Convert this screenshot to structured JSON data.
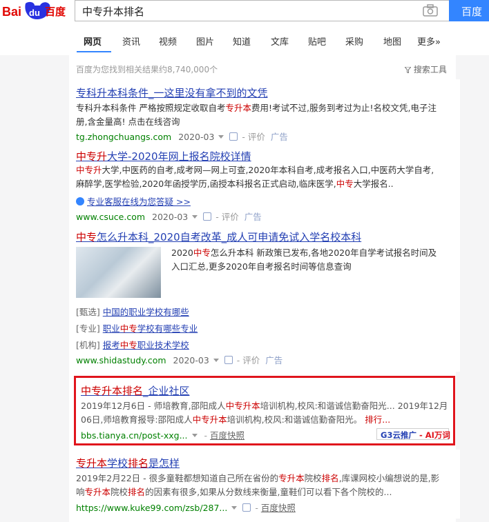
{
  "header": {
    "logo": {
      "bai": "Bai",
      "du": "du",
      "cn": "百度"
    },
    "query": "中专升本排名",
    "search_button": "百度一"
  },
  "tabs": [
    {
      "label": "网页",
      "active": true
    },
    {
      "label": "资讯"
    },
    {
      "label": "视频"
    },
    {
      "label": "图片"
    },
    {
      "label": "知道"
    },
    {
      "label": "文库"
    },
    {
      "label": "贴吧"
    },
    {
      "label": "采购"
    },
    {
      "label": "地图"
    },
    {
      "label": "更多»"
    }
  ],
  "result_count": "百度为您找到相关结果约8,740,000个",
  "search_tools": "搜索工具",
  "results": [
    {
      "title_parts": [
        "专科升本科条件_一这里没有拿不到的文凭"
      ],
      "desc_lines": [
        [
          "专科升本科条件 严格按照规定收取自考",
          {
            "r": "专升本"
          },
          "费用!考试不过,服务到考过为止!名校文凭,电子注"
        ],
        [
          "册,含金量高! 点击在线咨询"
        ]
      ],
      "url": "tg.zhongchuangs.com",
      "date": "2020-03",
      "review": "评价",
      "ad": "广告"
    },
    {
      "title_parts": [
        {
          "r": "中专升"
        },
        "大学-2020年网上报名院校详情"
      ],
      "desc_lines": [
        [
          {
            "r": "中专升"
          },
          "大学,中医药的自考,成考网—网上可查,2020年本科自考,成考报名入口,中医药大学自考,"
        ],
        [
          "麻醉学,医学检验,2020年函授学历,函授本科报名正式启动,临床医学,",
          {
            "r": "中专"
          },
          "大学报名.."
        ]
      ],
      "consult": "专业客服在线为您答疑 >>",
      "url": "www.csuce.com",
      "date": "2020-03",
      "review": "评价",
      "ad": "广告"
    },
    {
      "title_parts": [
        {
          "r": "中专"
        },
        "怎么升本科_2020自考改革_成人可申请免试入学名校本科"
      ],
      "desc_lines": [
        [
          "2020",
          {
            "r": "中专"
          },
          "怎么升本科 新政策已发布,各地2020年自学考试报名时间及"
        ],
        [
          "入口汇总,更多2020年自考报名时间等信息查询"
        ]
      ],
      "sublinks": [
        {
          "tag": "[甄选]",
          "parts": [
            "中国的职业学校有哪些"
          ]
        },
        {
          "tag": "[专业]",
          "parts": [
            "职业",
            {
              "r": "中专"
            },
            "学校有哪些专业"
          ]
        },
        {
          "tag": "[机构]",
          "parts": [
            "报考",
            {
              "r": "中专"
            },
            "职业技术学校"
          ]
        }
      ],
      "url": "www.shidastudy.com",
      "date": "2020-03",
      "review": "评价",
      "ad": "广告"
    },
    {
      "title_parts": [
        {
          "r": "中专升本排名"
        },
        "_企业社区"
      ],
      "desc_lines": [
        [
          "2019年12月6日 - 师培教育,邵阳成人",
          {
            "r": "中专升本"
          },
          "培训机构,校风:和谐诚信勤奋阳光... 2019年12月"
        ],
        [
          "06日,师培教育报导:邵阳成人",
          {
            "r": "中专升本"
          },
          "培训机构,校风:和谐诚信勤奋阳光。",
          {
            "r": " 排行..."
          }
        ]
      ],
      "url": "bbs.tianya.cn/post-xxg...",
      "snapshot": "百度快照",
      "tag": {
        "g3": "G3云推广",
        "sep": " - ",
        "ai": "AI万词"
      }
    },
    {
      "title_parts": [
        {
          "r": "专升本"
        },
        "学校",
        {
          "r": "排名"
        },
        "是怎样"
      ],
      "desc_lines": [
        [
          "2019年2月22日 - 很多童鞋都想知道自己所在省份的",
          {
            "r": "专升本"
          },
          "院校",
          {
            "r": "排名"
          },
          ",库课网校小编想说的是,影"
        ],
        [
          "响",
          {
            "r": "专升本"
          },
          "院校",
          {
            "r": "排名"
          },
          "的因素有很多,如果从分数线来衡量,童鞋们可以看下各个院校的..."
        ]
      ],
      "url": "https://www.kuke99.com/zsb/287...",
      "snapshot": "百度快照"
    }
  ],
  "colors": {
    "brand_blue": "#3385ff",
    "link": "#2440b3",
    "highlight": "#c00",
    "url_green": "#008000",
    "box_red": "#e0141c"
  }
}
